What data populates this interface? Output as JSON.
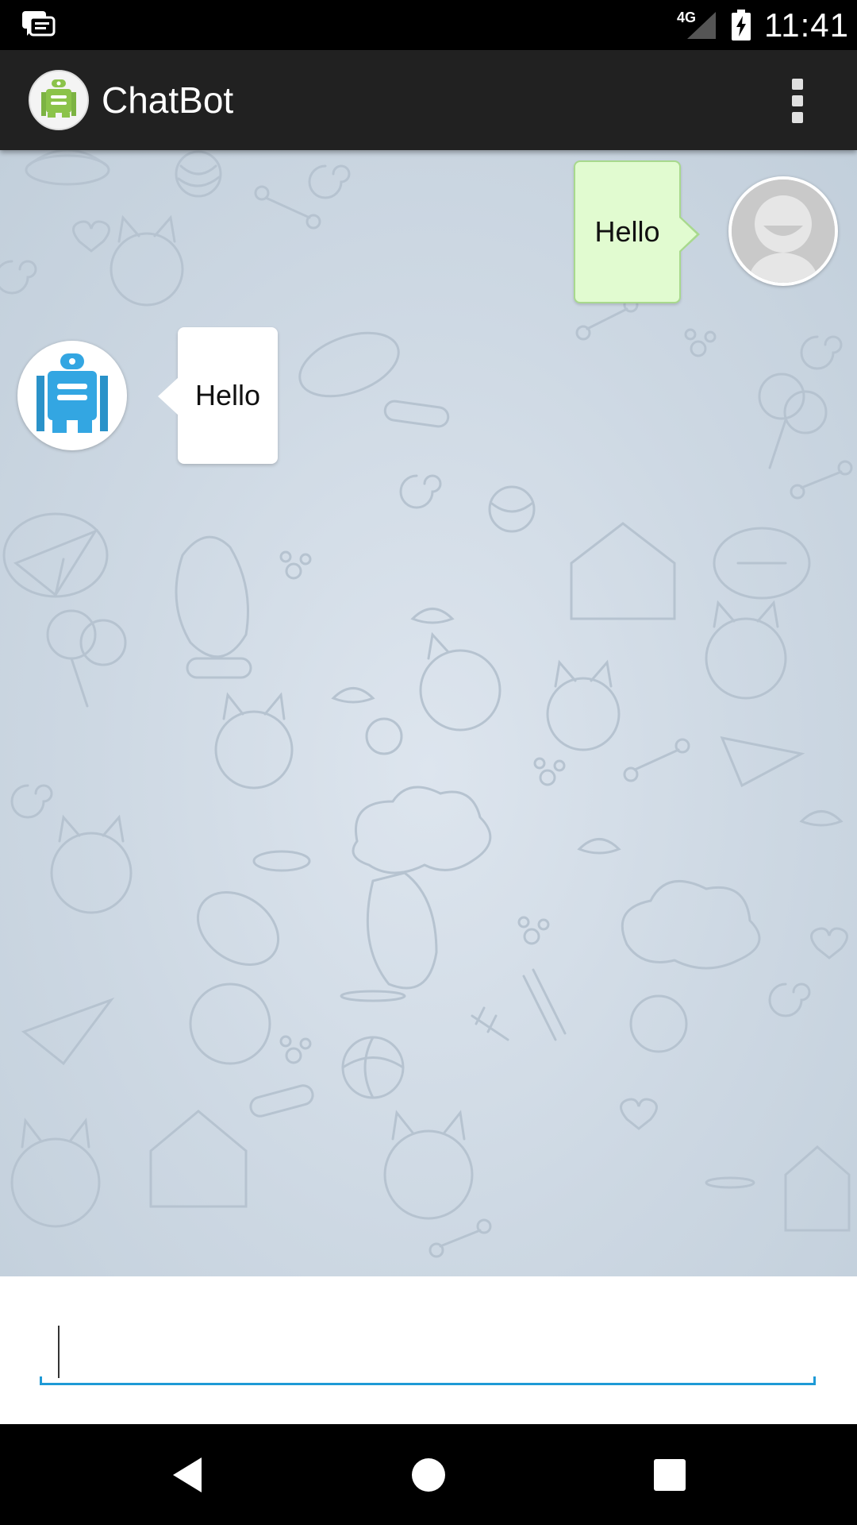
{
  "status_bar": {
    "network_label": "4G",
    "time": "11:41",
    "icons": [
      "chat-notification-icon",
      "signal-icon",
      "battery-charging-icon"
    ]
  },
  "toolbar": {
    "title": "ChatBot",
    "app_icon": "robot-icon",
    "menu_icon": "overflow-menu-icon"
  },
  "messages": [
    {
      "sender": "user",
      "text": "Hello",
      "avatar_icon": "user-avatar-icon"
    },
    {
      "sender": "bot",
      "text": "Hello",
      "avatar_icon": "robot-avatar-icon"
    }
  ],
  "input": {
    "value": "",
    "placeholder": ""
  },
  "nav_bar": {
    "icons": [
      "back-icon",
      "home-icon",
      "recents-icon"
    ]
  },
  "colors": {
    "toolbar_bg": "#212121",
    "user_bubble": "#e1fbd0",
    "bot_bubble": "#ffffff",
    "accent": "#1e9ad6",
    "robot_green": "#8bc34a",
    "robot_blue": "#33a6e2"
  }
}
